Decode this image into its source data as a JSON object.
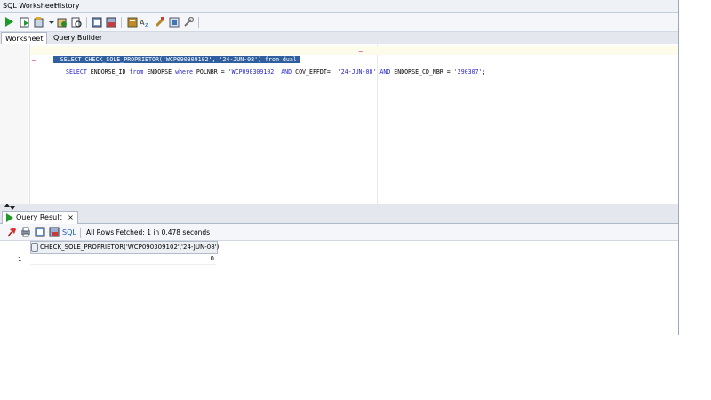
{
  "window": {
    "tabs": [
      "SQL Worksheet",
      "History"
    ]
  },
  "toolbar": {
    "icons": [
      "run-statement-icon",
      "run-script-icon",
      "commit-icon",
      "rollback-icon",
      "autotrace-icon",
      "explain-plan-icon",
      "sql-tuning-icon",
      "clear-icon",
      "history-icon",
      "unshared-worksheet-icon",
      "format-icon"
    ]
  },
  "worksheet": {
    "tabs": [
      "Worksheet",
      "Query Builder"
    ],
    "line1": "SELECT CHECK_SOLE_PROPRIETOR('WCP090309102', '24-JUN-08') from dual",
    "line2": {
      "select": "SELECT",
      "col": " ENDORSE_ID ",
      "from": "from",
      "tbl": " ENDORSE ",
      "where": "where",
      "cond1": " POLNBR = ",
      "val1": "'WCP090309102'",
      "and1": " AND ",
      "cond2": "COV_EFFDT=  ",
      "val2": "'24-JUN-08'",
      "and2": " AND ",
      "cond3": "ENDORSE_CD_NBR = ",
      "val3": "'290307'",
      "end": ";"
    }
  },
  "results": {
    "tab_label": "Query Result",
    "close_glyph": "×",
    "sql_label": "SQL",
    "status": "All Rows Fetched: 1 in 0.478 seconds",
    "column_header": "CHECK_SOLE_PROPRIETOR('WCP090309102','24-JUN-08')",
    "row_number": "1",
    "row_value": "0"
  },
  "colors": {
    "selection": "#2f5f9e",
    "keyword": "#2626c8",
    "run_green": "#1d9a2a"
  }
}
